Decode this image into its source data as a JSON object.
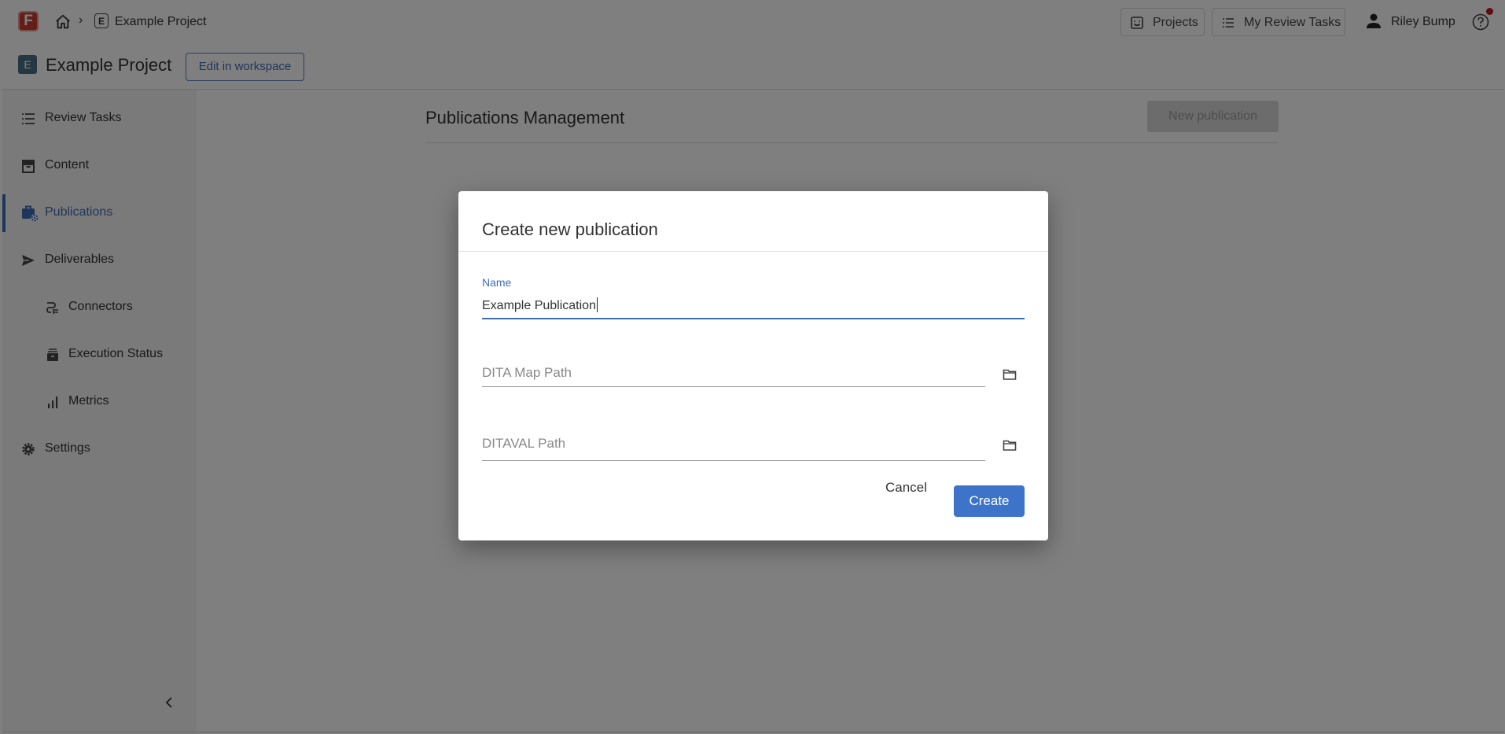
{
  "topbar": {
    "logo_letter": "F",
    "breadcrumb_badge": "E",
    "breadcrumb_project": "Example Project",
    "projects_label": "Projects",
    "review_tasks_label": "My Review Tasks",
    "user_name": "Riley Bump"
  },
  "project": {
    "badge": "E",
    "title": "Example Project",
    "edit_label": "Edit in workspace"
  },
  "sidebar": {
    "items": [
      {
        "label": "Review Tasks",
        "icon": "list-icon"
      },
      {
        "label": "Content",
        "icon": "archive-icon"
      },
      {
        "label": "Publications",
        "icon": "publications-icon",
        "active": true
      },
      {
        "label": "Deliverables",
        "icon": "send-icon"
      },
      {
        "label": "Connectors",
        "icon": "connector-icon"
      },
      {
        "label": "Execution Status",
        "icon": "stack-icon"
      },
      {
        "label": "Metrics",
        "icon": "bar-chart-icon"
      },
      {
        "label": "Settings",
        "icon": "gear-icon"
      }
    ]
  },
  "main": {
    "title": "Publications Management",
    "new_button": "New publication"
  },
  "dialog": {
    "title": "Create new publication",
    "name_label": "Name",
    "name_value": "Example Publication",
    "dita_map_placeholder": "DITA Map Path",
    "ditaval_placeholder": "DITAVAL Path",
    "cancel_label": "Cancel",
    "create_label": "Create"
  },
  "colors": {
    "accent": "#3f6db8",
    "primary_button": "#3d74c9",
    "logo": "#c93b2f",
    "project_badge": "#4a6e86",
    "notification": "#c0171c"
  }
}
